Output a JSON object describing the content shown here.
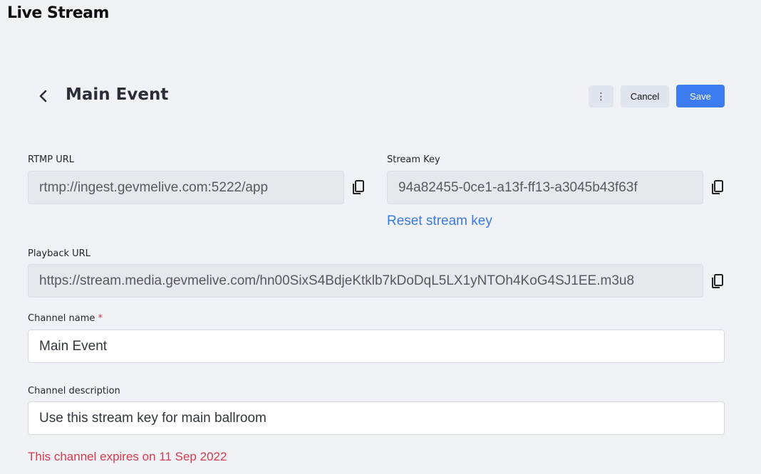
{
  "app": {
    "title": "Live Stream"
  },
  "header": {
    "title": "Main Event",
    "back_icon": "chevron-left-icon",
    "more_label": "⋮",
    "cancel_label": "Cancel",
    "save_label": "Save"
  },
  "form": {
    "rtmp": {
      "label": "RTMP URL",
      "value": "rtmp://ingest.gevmelive.com:5222/app"
    },
    "stream_key": {
      "label": "Stream Key",
      "value": "94a82455-0ce1-a13f-ff13-a3045b43f63f"
    },
    "reset_link": "Reset stream key",
    "playback": {
      "label": "Playback URL",
      "value": "https://stream.media.gevmelive.com/hn00SixS4BdjeKtklb7kDoDqL5LX1yNTOh4KoG4SJ1EE.m3u8"
    },
    "channel_name": {
      "label": "Channel name",
      "required_mark": "*",
      "value": "Main Event"
    },
    "channel_description": {
      "label": "Channel description",
      "value": "Use this stream key for main ballroom"
    },
    "expiry_notice": "This channel expires on 11 Sep 2022"
  },
  "icons": {
    "copy": "copy-icon"
  },
  "colors": {
    "primary": "#3d7cf0",
    "danger": "#d63a4c",
    "background": "#f1f2f6",
    "link": "#3a7be0"
  }
}
